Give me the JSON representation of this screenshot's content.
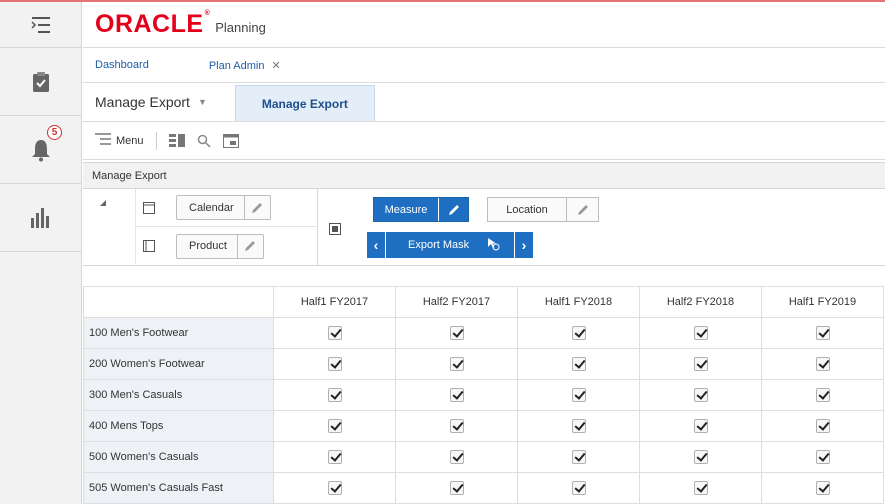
{
  "brand": {
    "logo": "ORACLE",
    "reg": "®",
    "product": "Planning"
  },
  "rail": {
    "notifications_count": "5"
  },
  "tabs": [
    {
      "label": "Dashboard"
    },
    {
      "label": "Plan Admin",
      "close": "✕"
    }
  ],
  "view": {
    "select_label": "Manage Export",
    "active_tab": "Manage Export"
  },
  "toolbar": {
    "menu_label": "Menu"
  },
  "panel": {
    "title": "Manage Export"
  },
  "pivot": {
    "row_dims": [
      {
        "label": "Calendar"
      },
      {
        "label": "Product"
      }
    ],
    "col_dims": [
      {
        "label": "Measure"
      },
      {
        "label": "Location"
      }
    ],
    "mask": {
      "label": "Export Mask"
    }
  },
  "grid": {
    "columns": [
      "Half1 FY2017",
      "Half2 FY2017",
      "Half1 FY2018",
      "Half2 FY2018",
      "Half1 FY2019"
    ],
    "rows": [
      {
        "label": "100 Men's Footwear",
        "checked": [
          true,
          true,
          true,
          true,
          true
        ]
      },
      {
        "label": "200 Women's Footwear",
        "checked": [
          true,
          true,
          true,
          true,
          true
        ]
      },
      {
        "label": "300 Men's Casuals",
        "checked": [
          true,
          true,
          true,
          true,
          true
        ]
      },
      {
        "label": "400 Mens Tops",
        "checked": [
          true,
          true,
          true,
          true,
          true
        ]
      },
      {
        "label": "500 Women's Casuals",
        "checked": [
          true,
          true,
          true,
          true,
          true
        ]
      },
      {
        "label": "505 Women's Casuals Fast",
        "checked": [
          true,
          true,
          true,
          true,
          true
        ]
      }
    ]
  },
  "colors": {
    "brand_red": "#e3001b",
    "accent_blue": "#1e6fc1",
    "link_blue": "#1f5da8"
  }
}
